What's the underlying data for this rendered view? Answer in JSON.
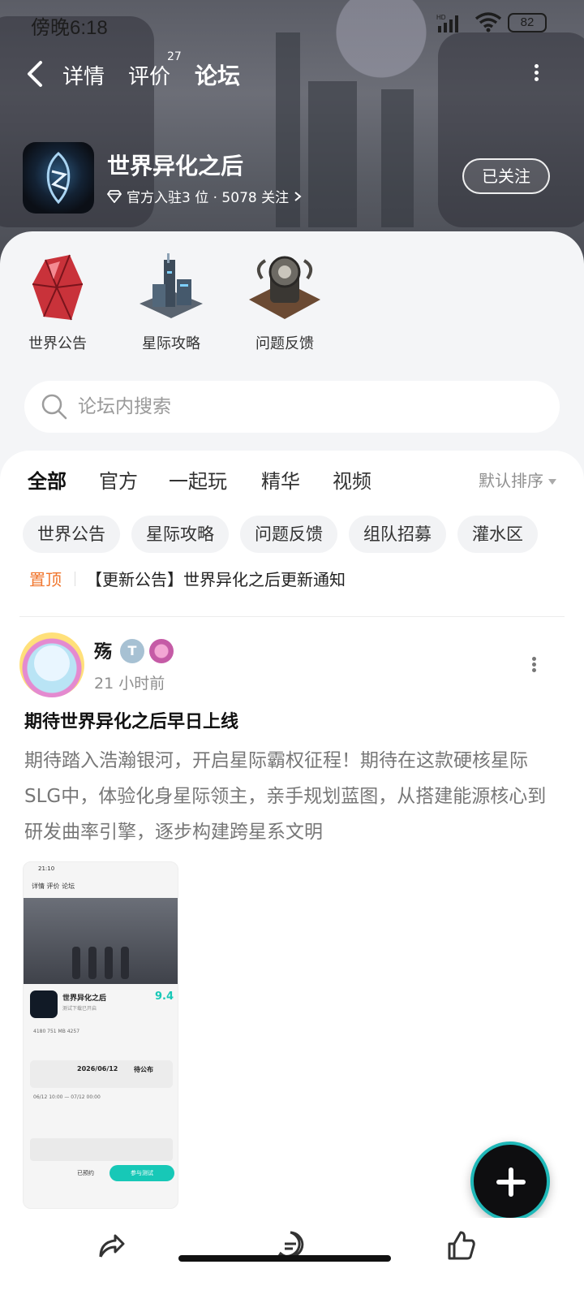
{
  "status_bar": {
    "time": "傍晚6:18",
    "battery": "82",
    "network": "HD"
  },
  "nav": {
    "tabs": [
      {
        "label": "详情"
      },
      {
        "label": "评价",
        "count": "27"
      },
      {
        "label": "论坛"
      }
    ],
    "active_tab": "论坛",
    "accent_color": "#17c8b7"
  },
  "game": {
    "name": "世界异化之后",
    "meta": "官方入驻3 位 · 5078 关注",
    "follow_label": "已关注"
  },
  "categories": [
    {
      "label": "世界公告",
      "icon": "red-crystal-icon"
    },
    {
      "label": "星际攻略",
      "icon": "station-building-icon"
    },
    {
      "label": "问题反馈",
      "icon": "reactor-core-icon"
    }
  ],
  "search": {
    "placeholder": "论坛内搜索"
  },
  "feed_tabs": [
    "全部",
    "官方",
    "一起玩",
    "精华",
    "视频"
  ],
  "sort_label": "默认排序",
  "chips": [
    "世界公告",
    "星际攻略",
    "问题反馈",
    "组队招募",
    "灌水区"
  ],
  "pinned": {
    "tag": "置顶",
    "text": "【更新公告】世界异化之后更新通知",
    "tag_color": "#f0762e"
  },
  "post": {
    "author": "殇",
    "badge": "T",
    "time": "21 小时前",
    "title": "期待世界异化之后早日上线",
    "body": "期待踏入浩瀚银河，开启星际霸权征程！期待在这款硬核星际SLG中，体验化身星际领主，亲手规划蓝图，从搭建能源核心到研发曲率引擎，逐步构建跨星系文明",
    "screenshot": {
      "status_time": "21:10",
      "tabs": "详情   评价   论坛",
      "game_name": "世界异化之后",
      "game_sub": "测试下载已开启",
      "score": "9.4",
      "stats": "4180      751 MB      4257",
      "date": "2026/06/12",
      "status": "待公布",
      "lines": "06/12 10:00 — 07/12 00:00",
      "reserve": "已预约",
      "button": "参与测试"
    }
  }
}
